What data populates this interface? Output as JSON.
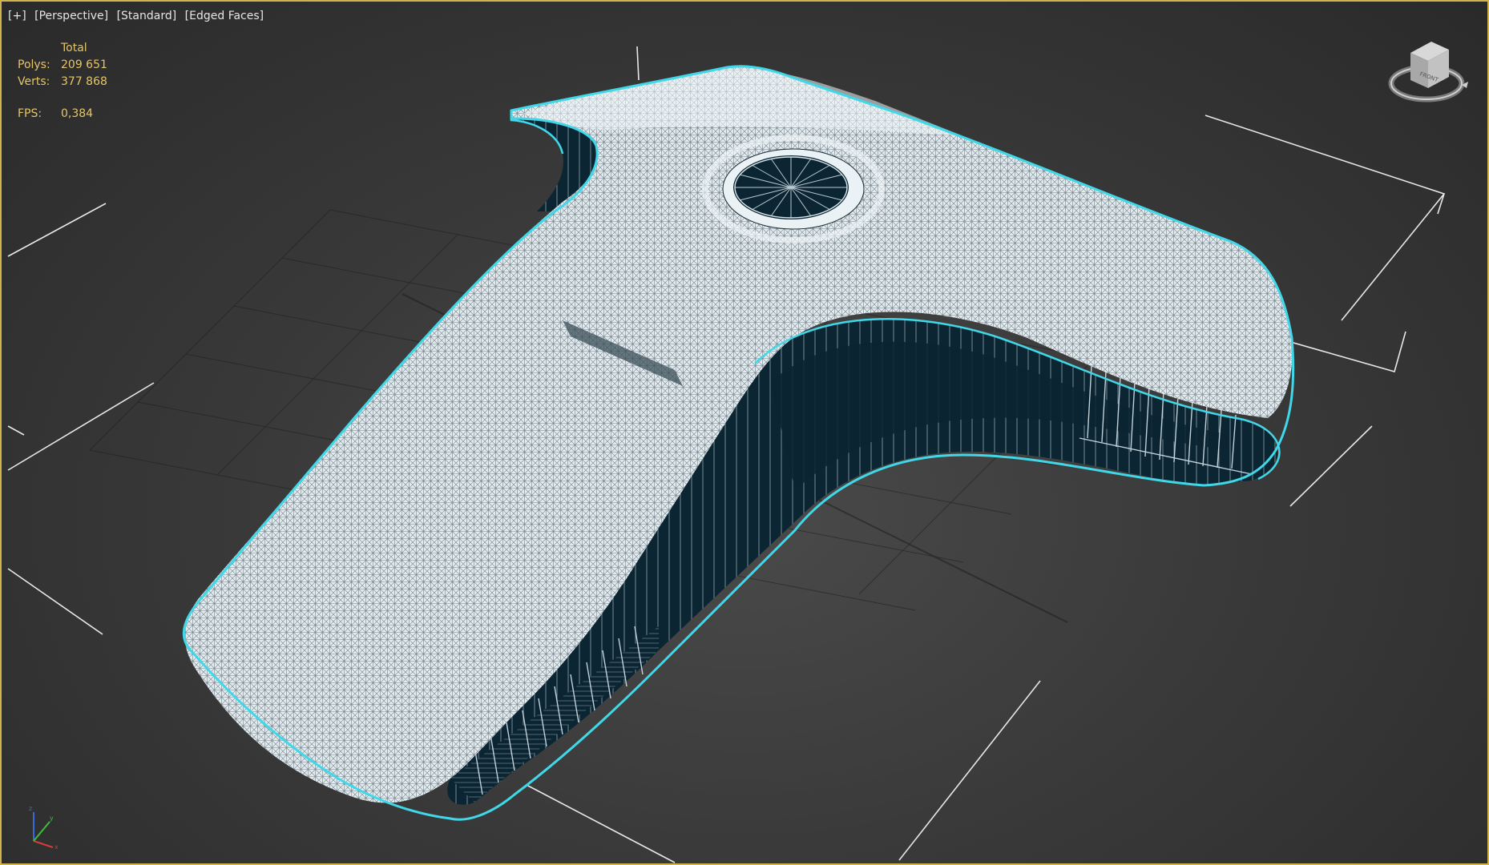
{
  "viewport": {
    "labels": [
      "[+]",
      "[Perspective]",
      "[Standard]",
      "[Edged Faces]"
    ]
  },
  "stats": {
    "header": "Total",
    "polys_label": "Polys:",
    "polys_value": "209 651",
    "verts_label": "Verts:",
    "verts_value": "377 868",
    "fps_label": "FPS:",
    "fps_value": "0,384"
  },
  "viewcube": {
    "face_label": "FRONT"
  },
  "colors": {
    "selection_outline": "#40d8e8",
    "mesh_face": "#dfe9ee",
    "mesh_dark": "#0a2330",
    "stats_text": "#e4c56a",
    "viewport_border": "#d2b24a"
  },
  "icons": [
    "viewcube-icon",
    "axis-tripod-icon"
  ]
}
